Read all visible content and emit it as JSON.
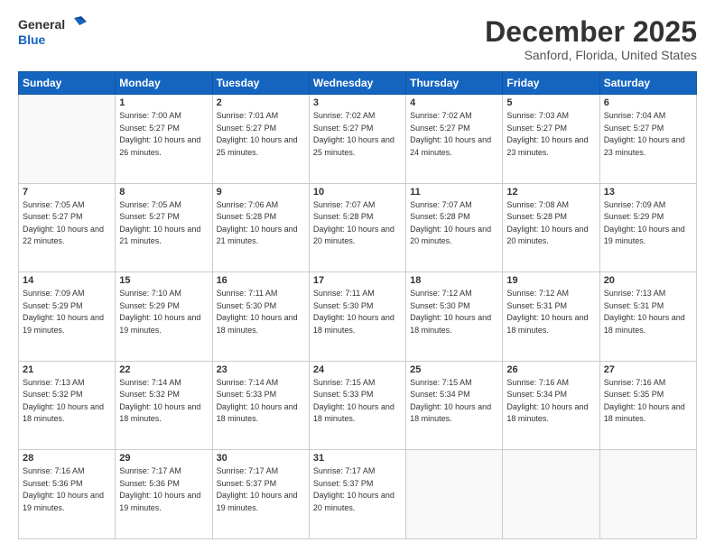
{
  "header": {
    "logo_line1": "General",
    "logo_line2": "Blue",
    "title": "December 2025",
    "subtitle": "Sanford, Florida, United States"
  },
  "calendar": {
    "headers": [
      "Sunday",
      "Monday",
      "Tuesday",
      "Wednesday",
      "Thursday",
      "Friday",
      "Saturday"
    ],
    "rows": [
      {
        "cells": [
          {
            "day": "",
            "empty": true
          },
          {
            "day": "1",
            "sunrise": "Sunrise: 7:00 AM",
            "sunset": "Sunset: 5:27 PM",
            "daylight": "Daylight: 10 hours and 26 minutes."
          },
          {
            "day": "2",
            "sunrise": "Sunrise: 7:01 AM",
            "sunset": "Sunset: 5:27 PM",
            "daylight": "Daylight: 10 hours and 25 minutes."
          },
          {
            "day": "3",
            "sunrise": "Sunrise: 7:02 AM",
            "sunset": "Sunset: 5:27 PM",
            "daylight": "Daylight: 10 hours and 25 minutes."
          },
          {
            "day": "4",
            "sunrise": "Sunrise: 7:02 AM",
            "sunset": "Sunset: 5:27 PM",
            "daylight": "Daylight: 10 hours and 24 minutes."
          },
          {
            "day": "5",
            "sunrise": "Sunrise: 7:03 AM",
            "sunset": "Sunset: 5:27 PM",
            "daylight": "Daylight: 10 hours and 23 minutes."
          },
          {
            "day": "6",
            "sunrise": "Sunrise: 7:04 AM",
            "sunset": "Sunset: 5:27 PM",
            "daylight": "Daylight: 10 hours and 23 minutes."
          }
        ]
      },
      {
        "cells": [
          {
            "day": "7",
            "sunrise": "Sunrise: 7:05 AM",
            "sunset": "Sunset: 5:27 PM",
            "daylight": "Daylight: 10 hours and 22 minutes."
          },
          {
            "day": "8",
            "sunrise": "Sunrise: 7:05 AM",
            "sunset": "Sunset: 5:27 PM",
            "daylight": "Daylight: 10 hours and 21 minutes."
          },
          {
            "day": "9",
            "sunrise": "Sunrise: 7:06 AM",
            "sunset": "Sunset: 5:28 PM",
            "daylight": "Daylight: 10 hours and 21 minutes."
          },
          {
            "day": "10",
            "sunrise": "Sunrise: 7:07 AM",
            "sunset": "Sunset: 5:28 PM",
            "daylight": "Daylight: 10 hours and 20 minutes."
          },
          {
            "day": "11",
            "sunrise": "Sunrise: 7:07 AM",
            "sunset": "Sunset: 5:28 PM",
            "daylight": "Daylight: 10 hours and 20 minutes."
          },
          {
            "day": "12",
            "sunrise": "Sunrise: 7:08 AM",
            "sunset": "Sunset: 5:28 PM",
            "daylight": "Daylight: 10 hours and 20 minutes."
          },
          {
            "day": "13",
            "sunrise": "Sunrise: 7:09 AM",
            "sunset": "Sunset: 5:29 PM",
            "daylight": "Daylight: 10 hours and 19 minutes."
          }
        ]
      },
      {
        "cells": [
          {
            "day": "14",
            "sunrise": "Sunrise: 7:09 AM",
            "sunset": "Sunset: 5:29 PM",
            "daylight": "Daylight: 10 hours and 19 minutes."
          },
          {
            "day": "15",
            "sunrise": "Sunrise: 7:10 AM",
            "sunset": "Sunset: 5:29 PM",
            "daylight": "Daylight: 10 hours and 19 minutes."
          },
          {
            "day": "16",
            "sunrise": "Sunrise: 7:11 AM",
            "sunset": "Sunset: 5:30 PM",
            "daylight": "Daylight: 10 hours and 18 minutes."
          },
          {
            "day": "17",
            "sunrise": "Sunrise: 7:11 AM",
            "sunset": "Sunset: 5:30 PM",
            "daylight": "Daylight: 10 hours and 18 minutes."
          },
          {
            "day": "18",
            "sunrise": "Sunrise: 7:12 AM",
            "sunset": "Sunset: 5:30 PM",
            "daylight": "Daylight: 10 hours and 18 minutes."
          },
          {
            "day": "19",
            "sunrise": "Sunrise: 7:12 AM",
            "sunset": "Sunset: 5:31 PM",
            "daylight": "Daylight: 10 hours and 18 minutes."
          },
          {
            "day": "20",
            "sunrise": "Sunrise: 7:13 AM",
            "sunset": "Sunset: 5:31 PM",
            "daylight": "Daylight: 10 hours and 18 minutes."
          }
        ]
      },
      {
        "cells": [
          {
            "day": "21",
            "sunrise": "Sunrise: 7:13 AM",
            "sunset": "Sunset: 5:32 PM",
            "daylight": "Daylight: 10 hours and 18 minutes."
          },
          {
            "day": "22",
            "sunrise": "Sunrise: 7:14 AM",
            "sunset": "Sunset: 5:32 PM",
            "daylight": "Daylight: 10 hours and 18 minutes."
          },
          {
            "day": "23",
            "sunrise": "Sunrise: 7:14 AM",
            "sunset": "Sunset: 5:33 PM",
            "daylight": "Daylight: 10 hours and 18 minutes."
          },
          {
            "day": "24",
            "sunrise": "Sunrise: 7:15 AM",
            "sunset": "Sunset: 5:33 PM",
            "daylight": "Daylight: 10 hours and 18 minutes."
          },
          {
            "day": "25",
            "sunrise": "Sunrise: 7:15 AM",
            "sunset": "Sunset: 5:34 PM",
            "daylight": "Daylight: 10 hours and 18 minutes."
          },
          {
            "day": "26",
            "sunrise": "Sunrise: 7:16 AM",
            "sunset": "Sunset: 5:34 PM",
            "daylight": "Daylight: 10 hours and 18 minutes."
          },
          {
            "day": "27",
            "sunrise": "Sunrise: 7:16 AM",
            "sunset": "Sunset: 5:35 PM",
            "daylight": "Daylight: 10 hours and 18 minutes."
          }
        ]
      },
      {
        "cells": [
          {
            "day": "28",
            "sunrise": "Sunrise: 7:16 AM",
            "sunset": "Sunset: 5:36 PM",
            "daylight": "Daylight: 10 hours and 19 minutes."
          },
          {
            "day": "29",
            "sunrise": "Sunrise: 7:17 AM",
            "sunset": "Sunset: 5:36 PM",
            "daylight": "Daylight: 10 hours and 19 minutes."
          },
          {
            "day": "30",
            "sunrise": "Sunrise: 7:17 AM",
            "sunset": "Sunset: 5:37 PM",
            "daylight": "Daylight: 10 hours and 19 minutes."
          },
          {
            "day": "31",
            "sunrise": "Sunrise: 7:17 AM",
            "sunset": "Sunset: 5:37 PM",
            "daylight": "Daylight: 10 hours and 20 minutes."
          },
          {
            "day": "",
            "empty": true
          },
          {
            "day": "",
            "empty": true
          },
          {
            "day": "",
            "empty": true
          }
        ]
      }
    ]
  }
}
